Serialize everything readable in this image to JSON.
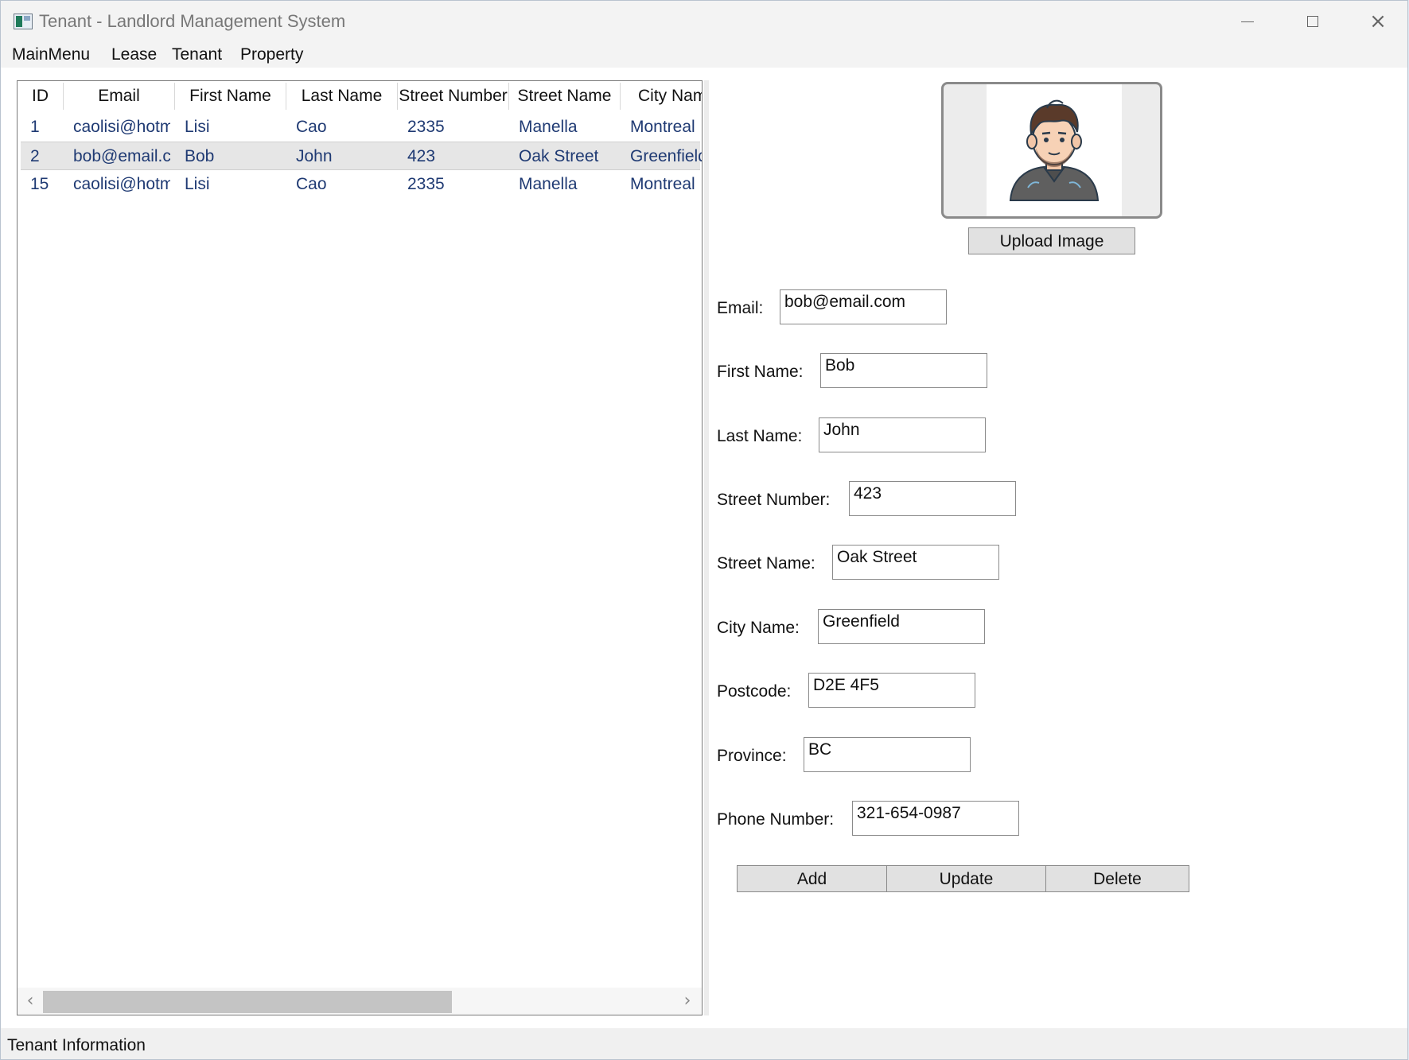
{
  "window": {
    "title": "Tenant - Landlord Management System"
  },
  "menu": {
    "items": [
      "MainMenu",
      "Lease",
      "Tenant",
      "Property"
    ]
  },
  "grid": {
    "columns": [
      "ID",
      "Email",
      "First Name",
      "Last Name",
      "Street Number",
      "Street Name",
      "City Name"
    ],
    "rows": [
      [
        "1",
        "caolisi@hotmail.com",
        "Lisi",
        "Cao",
        "2335",
        "Manella",
        "Montreal"
      ],
      [
        "2",
        "bob@email.com",
        "Bob",
        "John",
        "423",
        "Oak Street",
        "Greenfield"
      ],
      [
        "15",
        "caolisi@hotmail.com",
        "Lisi",
        "Cao",
        "2335",
        "Manella",
        "Montreal"
      ]
    ],
    "selected_row": 1
  },
  "scroll": {
    "left_icon": "‹",
    "right_icon": "›"
  },
  "upload": {
    "label": "Upload Image"
  },
  "form": {
    "email": {
      "label": "Email:",
      "value": "bob@email.com"
    },
    "first_name": {
      "label": "First Name:",
      "value": "Bob"
    },
    "last_name": {
      "label": "Last Name:",
      "value": "John"
    },
    "street_number": {
      "label": "Street Number:",
      "value": "423"
    },
    "street_name": {
      "label": "Street Name:",
      "value": "Oak Street"
    },
    "city_name": {
      "label": "City Name:",
      "value": "Greenfield"
    },
    "postcode": {
      "label": "Postcode:",
      "value": "D2E 4F5"
    },
    "province": {
      "label": "Province:",
      "value": "BC"
    },
    "phone_number": {
      "label": "Phone Number:",
      "value": "321-654-0987"
    }
  },
  "actions": {
    "add": "Add",
    "update": "Update",
    "delete": "Delete"
  },
  "status": {
    "text": "Tenant Information"
  },
  "icons": {
    "app": "app-window-icon",
    "avatar": "user-avatar-illustration",
    "close": "×"
  },
  "colors": {
    "cell_text": "#1f3a73",
    "selected_row": "#e6e6e6",
    "button_bg": "#e1e1e1"
  }
}
